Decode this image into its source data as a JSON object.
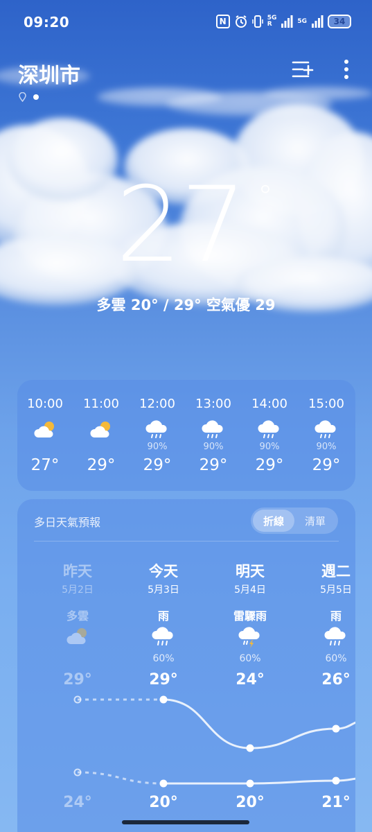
{
  "status_bar": {
    "time": "09:20",
    "net1": "5G",
    "net1_sub": "R",
    "net2": "5G",
    "battery": "34"
  },
  "header": {
    "city": "深圳市"
  },
  "current": {
    "temperature": "27",
    "degree_symbol": "°",
    "summary": "多雲  20° / 29°  空氣優 29"
  },
  "hourly": [
    {
      "time": "10:00",
      "icon": "partly-cloudy-icon",
      "pop": "",
      "temp": "27°"
    },
    {
      "time": "11:00",
      "icon": "partly-cloudy-icon",
      "pop": "",
      "temp": "29°"
    },
    {
      "time": "12:00",
      "icon": "rain-icon",
      "pop": "90%",
      "temp": "29°"
    },
    {
      "time": "13:00",
      "icon": "rain-icon",
      "pop": "90%",
      "temp": "29°"
    },
    {
      "time": "14:00",
      "icon": "rain-icon",
      "pop": "90%",
      "temp": "29°"
    },
    {
      "time": "15:00",
      "icon": "rain-icon",
      "pop": "90%",
      "temp": "29°"
    }
  ],
  "daily": {
    "title": "多日天氣預報",
    "toggle": {
      "option_line": "折線",
      "option_list": "清單",
      "active": "折線"
    },
    "days": [
      {
        "name": "昨天",
        "date": "5月2日",
        "condition": "多雲",
        "icon": "partly-cloudy-icon",
        "pop": "",
        "high": "29°",
        "low": "24°",
        "high_value": 29,
        "low_value": 24,
        "past": true
      },
      {
        "name": "今天",
        "date": "5月3日",
        "condition": "雨",
        "icon": "rain-icon",
        "pop": "60%",
        "high": "29°",
        "low": "20°",
        "high_value": 29,
        "low_value": 20,
        "past": false
      },
      {
        "name": "明天",
        "date": "5月4日",
        "condition": "雷驟雨",
        "icon": "thunderstorm-icon",
        "pop": "60%",
        "high": "24°",
        "low": "20°",
        "high_value": 24,
        "low_value": 20,
        "past": false
      },
      {
        "name": "週二",
        "date": "5月5日",
        "condition": "雨",
        "icon": "rain-icon",
        "pop": "60%",
        "high": "26°",
        "low": "21°",
        "high_value": 26,
        "low_value": 21,
        "past": false
      }
    ]
  }
}
